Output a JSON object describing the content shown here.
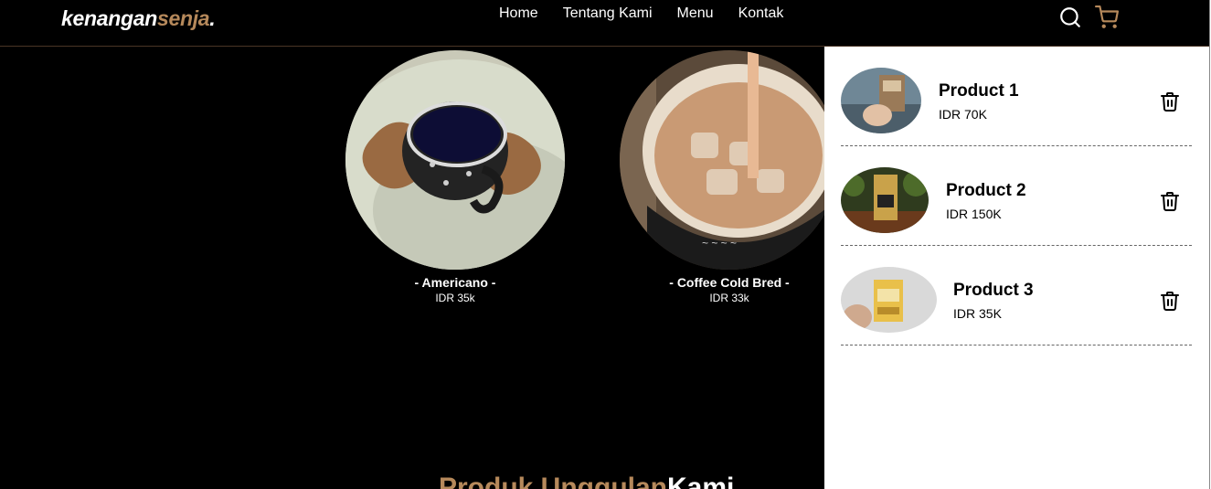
{
  "brand": {
    "part1": "kenangan",
    "part2": "senja",
    "dot": "."
  },
  "nav": {
    "items": [
      {
        "label": "Home"
      },
      {
        "label": "Tentang Kami"
      },
      {
        "label": "Menu"
      },
      {
        "label": "Kontak"
      }
    ]
  },
  "icons": {
    "search": "search-icon",
    "cart": "shopping-cart-icon"
  },
  "menu": [
    {
      "title": "- Americano -",
      "price": "IDR 35k"
    },
    {
      "title": "- Coffee Cold Bred -",
      "price": "IDR 33k"
    }
  ],
  "section": {
    "title_a": "Produk Unggulan",
    "title_b": "Kami"
  },
  "cart": {
    "items": [
      {
        "name": "Product 1",
        "price": "IDR 70K"
      },
      {
        "name": "Product 2",
        "price": "IDR 150K"
      },
      {
        "name": "Product 3",
        "price": "IDR 35K"
      }
    ]
  },
  "colors": {
    "accent": "#b6895b",
    "background": "#000000",
    "panel": "#ffffff"
  }
}
